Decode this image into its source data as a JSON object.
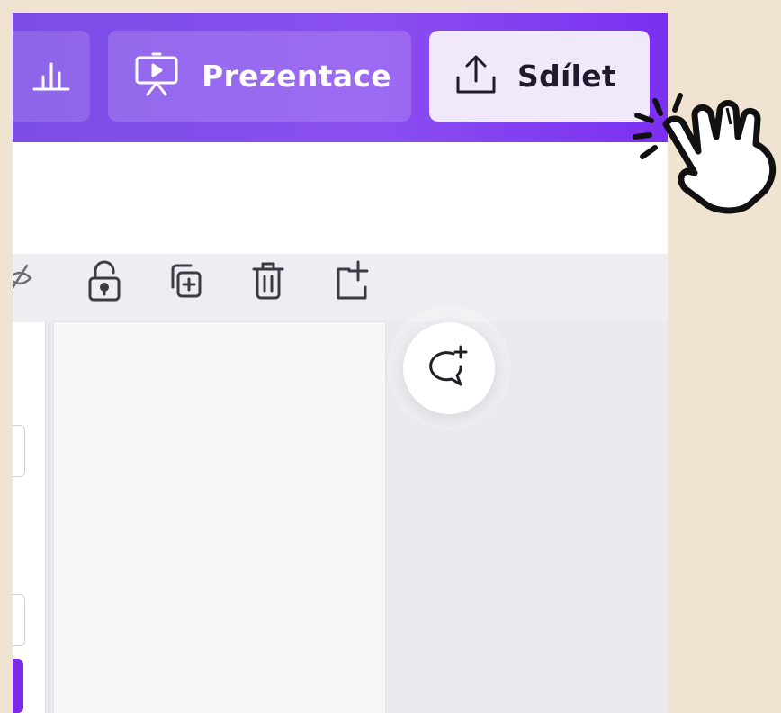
{
  "topbar": {
    "present_label": "Prezentace",
    "share_label": "Sdílet"
  },
  "icons": {
    "stats": "bar-chart-icon",
    "present": "presentation-icon",
    "share": "upload-icon",
    "hide": "eye-off-icon",
    "lock": "lock-icon",
    "duplicate": "duplicate-icon",
    "delete": "trash-icon",
    "add_page": "add-page-icon",
    "comment": "add-comment-icon",
    "pointer": "hand-pointer-icon"
  },
  "colors": {
    "brand_purple": "#8a4ff0",
    "background": "#f1e3d2",
    "share_button": "#f1e8fb"
  }
}
